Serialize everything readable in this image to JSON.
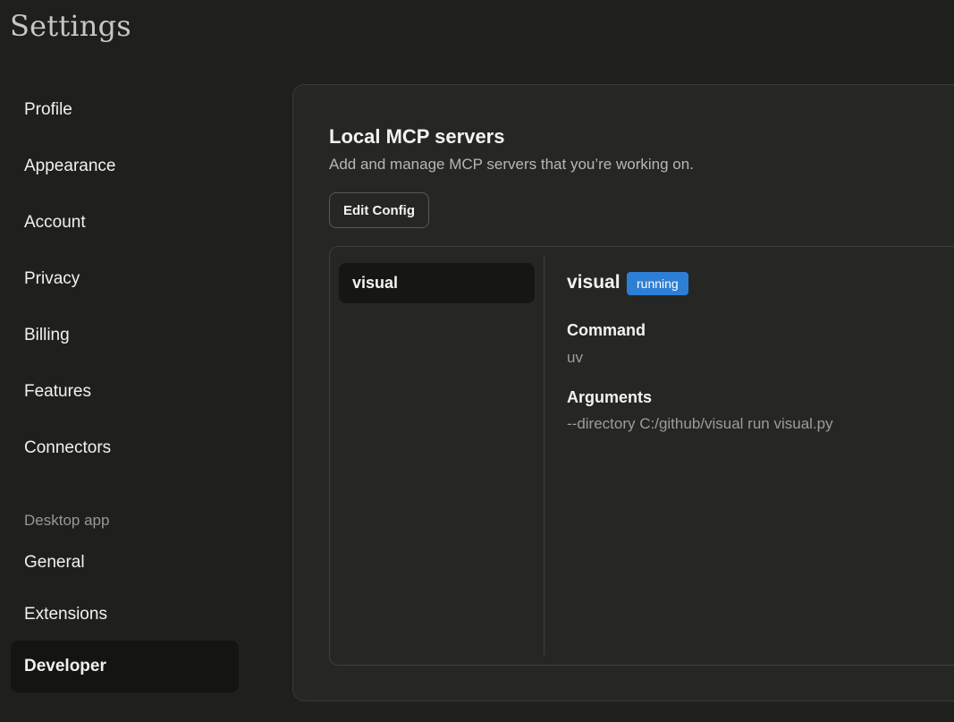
{
  "page": {
    "title": "Settings"
  },
  "sidebar": {
    "items": [
      {
        "label": "Profile"
      },
      {
        "label": "Appearance"
      },
      {
        "label": "Account"
      },
      {
        "label": "Privacy"
      },
      {
        "label": "Billing"
      },
      {
        "label": "Features"
      },
      {
        "label": "Connectors"
      }
    ],
    "section_label": "Desktop app",
    "desktop_items": [
      {
        "label": "General"
      },
      {
        "label": "Extensions"
      },
      {
        "label": "Developer",
        "active": true
      }
    ]
  },
  "main": {
    "title": "Local MCP servers",
    "subtitle": "Add and manage MCP servers that you’re working on.",
    "edit_config_label": "Edit Config",
    "servers": [
      {
        "name": "visual",
        "selected": true
      }
    ],
    "detail": {
      "name": "visual",
      "status": "running",
      "status_color": "#2d7fd6",
      "command_label": "Command",
      "command_value": "uv",
      "arguments_label": "Arguments",
      "arguments_value": "--directory C:/github/visual run visual.py"
    }
  }
}
